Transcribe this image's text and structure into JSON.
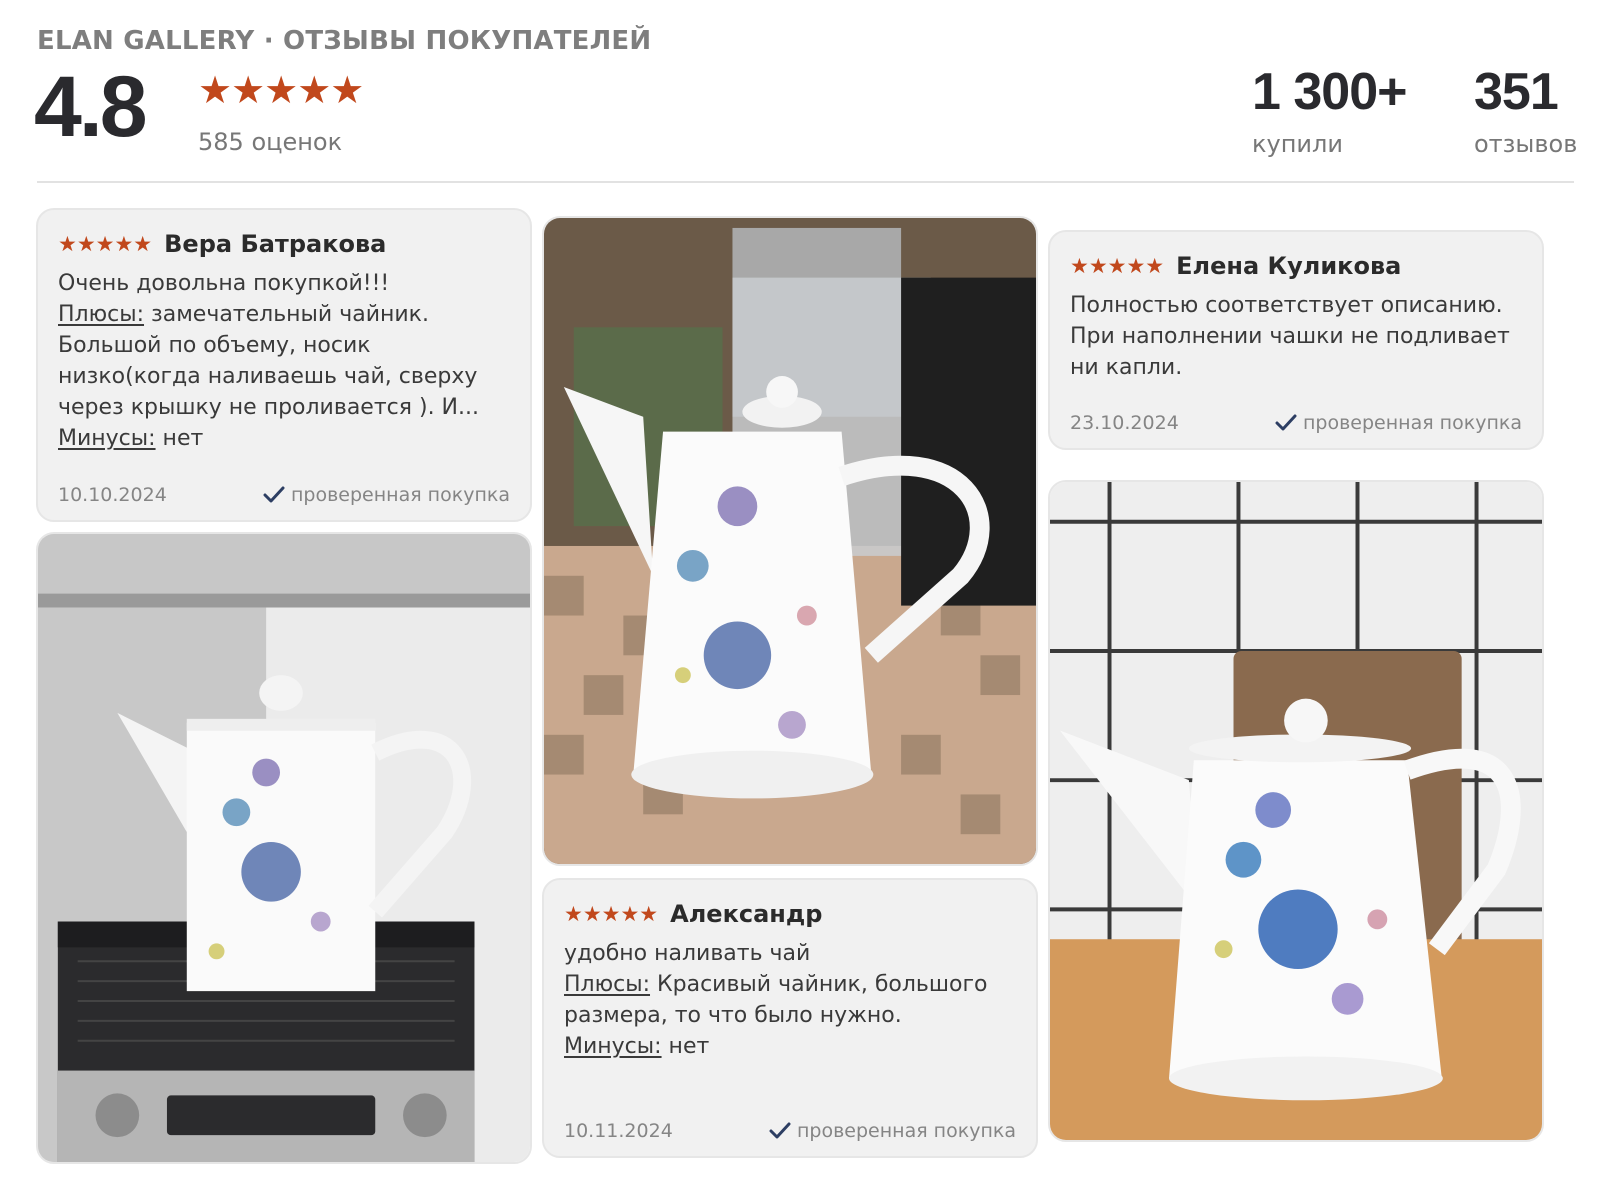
{
  "header": {
    "brand": "ELAN GALLERY · ОТЗЫВЫ ПОКУПАТЕЛЕЙ",
    "rating": "4.8",
    "stars": "★★★★★",
    "rating_count": "585 оценок",
    "bought_value": "1 300+",
    "bought_label": "купили",
    "reviews_value": "351",
    "reviews_label": "отзывов",
    "star_color": "#c1481c"
  },
  "reviews": [
    {
      "stars": "★★★★★",
      "author": "Вера Батракова",
      "text": "Очень довольна покупкой!!!",
      "pros_label": "Плюсы:",
      "pros": " замечательный чайник. Большой по объему, носик низко(когда наливаешь чай, сверху через крышку не проливается ). И...",
      "cons_label": "Минусы:",
      "cons": " нет",
      "date": "10.10.2024",
      "verified": "проверенная покупка"
    },
    {
      "stars": "★★★★★",
      "author": "Елена Куликова",
      "text": "Полностью соответствует описанию. При наполнении чашки не подливает ни капли.",
      "date": "23.10.2024",
      "verified": "проверенная покупка"
    },
    {
      "stars": "★★★★★",
      "author": "Александр",
      "text": "удобно наливать чай",
      "pros_label": "Плюсы:",
      "pros": " Красивый чайник, большого размера, то что было нужно.",
      "cons_label": "Минусы:",
      "cons": " нет",
      "date": "10.11.2024",
      "verified": "проверенная покупка"
    }
  ],
  "photos": [
    {
      "subject": "teapot on coffee machine"
    },
    {
      "subject": "teapot near electric kettle"
    },
    {
      "subject": "teapot on wooden table"
    }
  ]
}
